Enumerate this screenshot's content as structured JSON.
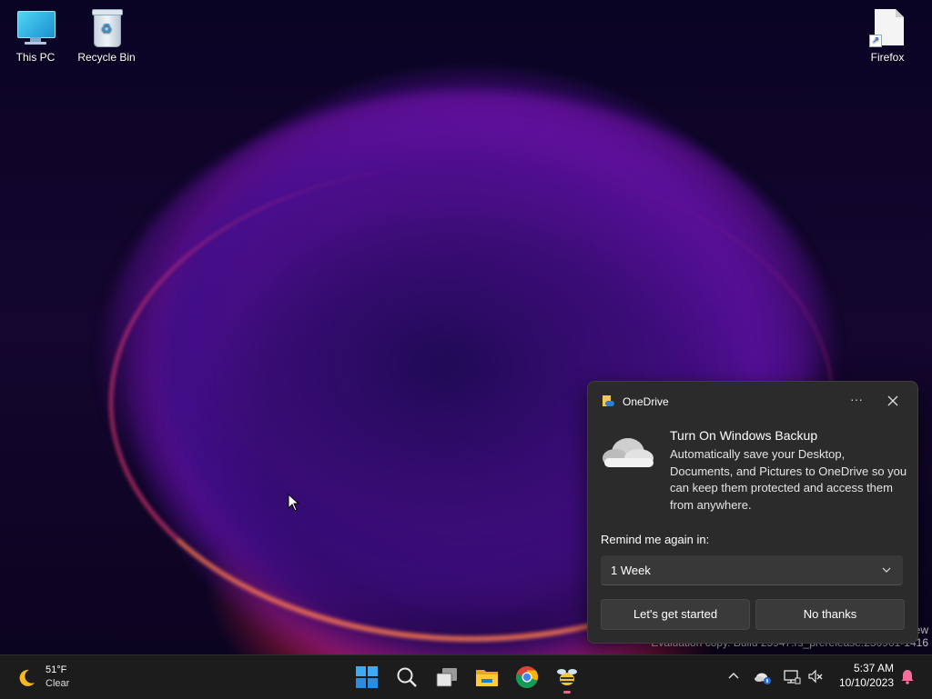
{
  "desktop": {
    "icons": [
      {
        "label": "This PC"
      },
      {
        "label": "Recycle Bin"
      },
      {
        "label": "Firefox"
      }
    ],
    "watermark": {
      "line1": "ew",
      "line2": "Evaluation copy. Build 25947.rs_prerelease.230901-1416"
    }
  },
  "toast": {
    "app_name": "OneDrive",
    "more_label": "···",
    "title": "Turn On Windows Backup",
    "body": "Automatically save your Desktop, Documents, and Pictures to OneDrive so you can keep them protected and access them from anywhere.",
    "remind_label": "Remind me again in:",
    "remind_value": "1 Week",
    "primary_button": "Let's get started",
    "secondary_button": "No thanks"
  },
  "taskbar": {
    "weather": {
      "temp": "51°F",
      "condition": "Clear",
      "icon": "moon-icon"
    },
    "apps": [
      "start-icon",
      "search-icon",
      "task-view-icon",
      "file-explorer-icon",
      "chrome-icon",
      "app-icon"
    ],
    "tray_icons": [
      "chevron-up-icon",
      "onedrive-icon",
      "network-icon",
      "volume-muted-icon",
      "bell-icon"
    ],
    "clock": {
      "time": "5:37 AM",
      "date": "10/10/2023"
    }
  },
  "colors": {
    "taskbar": "#1c1c1c",
    "toast_bg": "#2b2b2b",
    "button_bg": "#3a3a3a"
  }
}
